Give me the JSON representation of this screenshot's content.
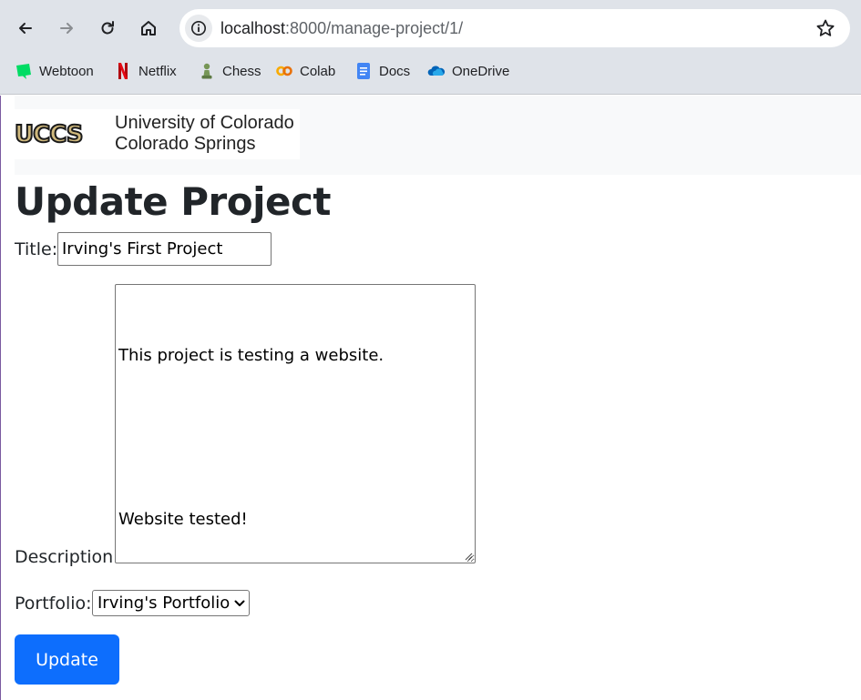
{
  "browser": {
    "url_host": "localhost",
    "url_path": ":8000/manage-project/1/",
    "bookmarks": [
      {
        "label": "Webtoon",
        "icon": "webtoon-icon",
        "color": "#00dc64"
      },
      {
        "label": "Netflix",
        "icon": "netflix-icon",
        "color": "#e50914"
      },
      {
        "label": "Chess",
        "icon": "chess-pawn-icon",
        "color": "#769656"
      },
      {
        "label": "Colab",
        "icon": "colab-icon",
        "color": "#f9ab00"
      },
      {
        "label": "Docs",
        "icon": "docs-icon",
        "color": "#4285f4"
      },
      {
        "label": "OneDrive",
        "icon": "onedrive-icon",
        "color": "#0364b8"
      }
    ]
  },
  "header": {
    "logo_mark": "UCCS",
    "logo_line1": "University of Colorado",
    "logo_line2": "Colorado Springs"
  },
  "form": {
    "heading": "Update Project",
    "title_label": "Title:",
    "title_value": "Irving's First Project",
    "description_label": "Description:",
    "description_lines": [
      "This project is testing a website.",
      "",
      "Website tested!"
    ],
    "portfolio_label": "Portfolio:",
    "portfolio_selected": "Irving's Portfolio",
    "submit_label": "Update"
  },
  "colors": {
    "primary_button": "#0d6efd",
    "header_band": "#f8f9fa",
    "chrome": "#dfe3e9"
  }
}
